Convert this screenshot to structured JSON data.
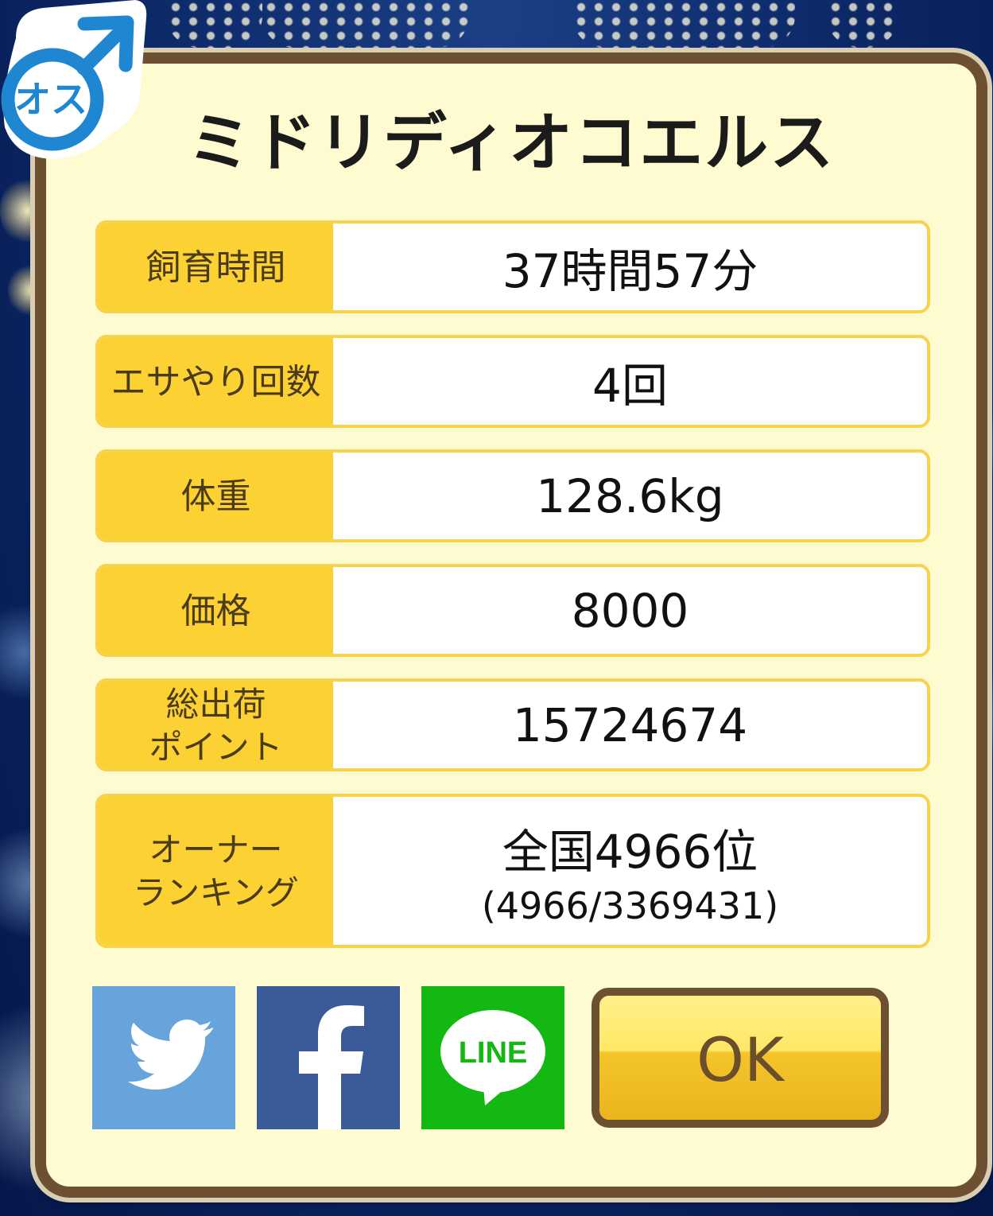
{
  "character": {
    "name": "ミドリディオコエルス",
    "gender_badge_text": "オス",
    "gender_icon": "male-icon"
  },
  "stats": [
    {
      "label": "飼育時間",
      "value": "37時間57分"
    },
    {
      "label": "エサやり回数",
      "value": "4回"
    },
    {
      "label": "体重",
      "value": "128.6kg"
    },
    {
      "label": "価格",
      "value": "8000"
    },
    {
      "label_line1": "総出荷",
      "label_line2": "ポイント",
      "value": "15724674"
    },
    {
      "label_line1": "オーナー",
      "label_line2": "ランキング",
      "value": "全国4966位",
      "sub_value": "(4966/3369431)"
    }
  ],
  "share": {
    "twitter_icon": "twitter-bird-icon",
    "facebook_icon": "facebook-f-icon",
    "line_text": "LINE"
  },
  "buttons": {
    "ok_label": "OK"
  },
  "colors": {
    "panel_bg": "#fffbd0",
    "panel_border": "#6d4f31",
    "label_bg": "#fcd133",
    "twitter": "#67a4dc",
    "facebook": "#3a5a98",
    "line": "#13b812",
    "male_blue": "#1f86d2"
  }
}
